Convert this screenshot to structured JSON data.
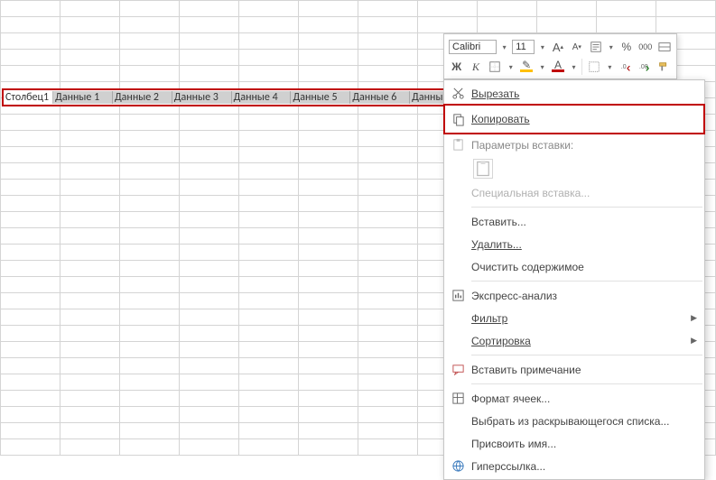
{
  "row": {
    "c0": "Столбец1",
    "c1": "Данные 1",
    "c2": "Данные 2",
    "c3": "Данные 3",
    "c4": "Данные 4",
    "c5": "Данные 5",
    "c6": "Данные 6",
    "c7": "Данны"
  },
  "minitool": {
    "font": "Calibri",
    "size": "11",
    "inc": "A",
    "dec": "A",
    "percent": "%",
    "thousand": "000",
    "bold": "Ж",
    "italic": "К",
    "fillA": "A",
    "fontA": "A"
  },
  "menu": {
    "cut": "Вырезать",
    "copy": "Копировать",
    "pasteopts": "Параметры вставки:",
    "pastespecial": "Специальная вставка...",
    "insert": "Вставить...",
    "delete": "Удалить...",
    "clear": "Очистить содержимое",
    "quick": "Экспресс-анализ",
    "filter": "Фильтр",
    "sort": "Сортировка",
    "comment": "Вставить примечание",
    "format": "Формат ячеек...",
    "dropdown": "Выбрать из раскрывающегося списка...",
    "definename": "Присвоить имя...",
    "hyperlink": "Гиперссылка..."
  }
}
